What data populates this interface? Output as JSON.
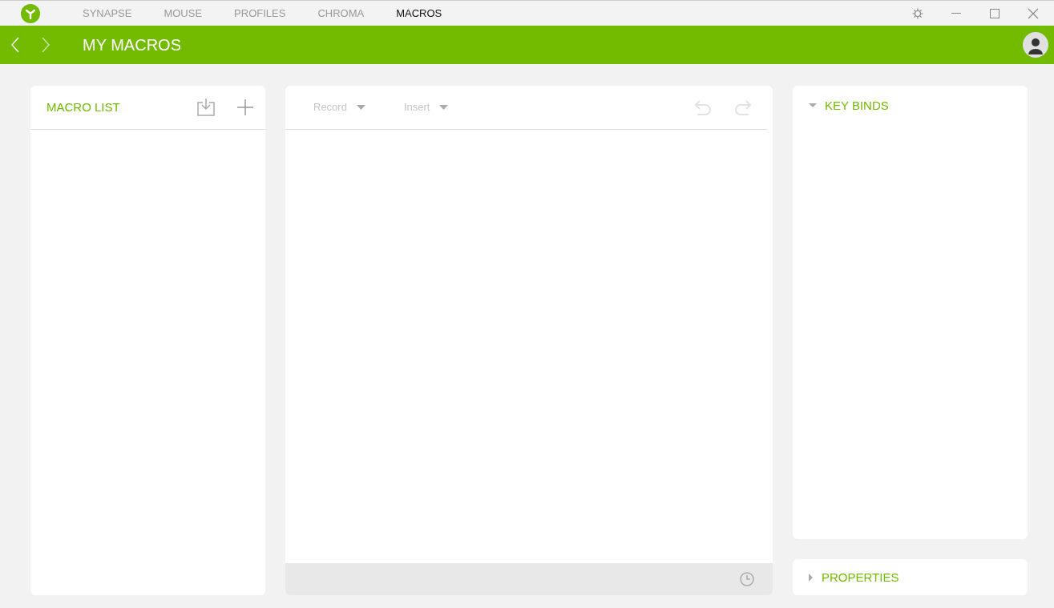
{
  "nav_tabs": [
    {
      "label": "SYNAPSE",
      "selected": false
    },
    {
      "label": "MOUSE",
      "selected": false
    },
    {
      "label": "PROFILES",
      "selected": false
    },
    {
      "label": "CHROMA",
      "selected": false
    },
    {
      "label": "MACROS",
      "selected": true
    }
  ],
  "page_title": "MY MACROS",
  "macro_list": {
    "title": "MACRO LIST"
  },
  "editor": {
    "dropdowns": [
      {
        "label": "Record",
        "disabled": true
      },
      {
        "label": "Insert",
        "disabled": true
      }
    ],
    "undo_disabled": true,
    "redo_disabled": true
  },
  "sections": [
    {
      "title": "KEY BINDS",
      "expanded": true
    },
    {
      "title": "PROPERTIES",
      "expanded": false
    }
  ]
}
